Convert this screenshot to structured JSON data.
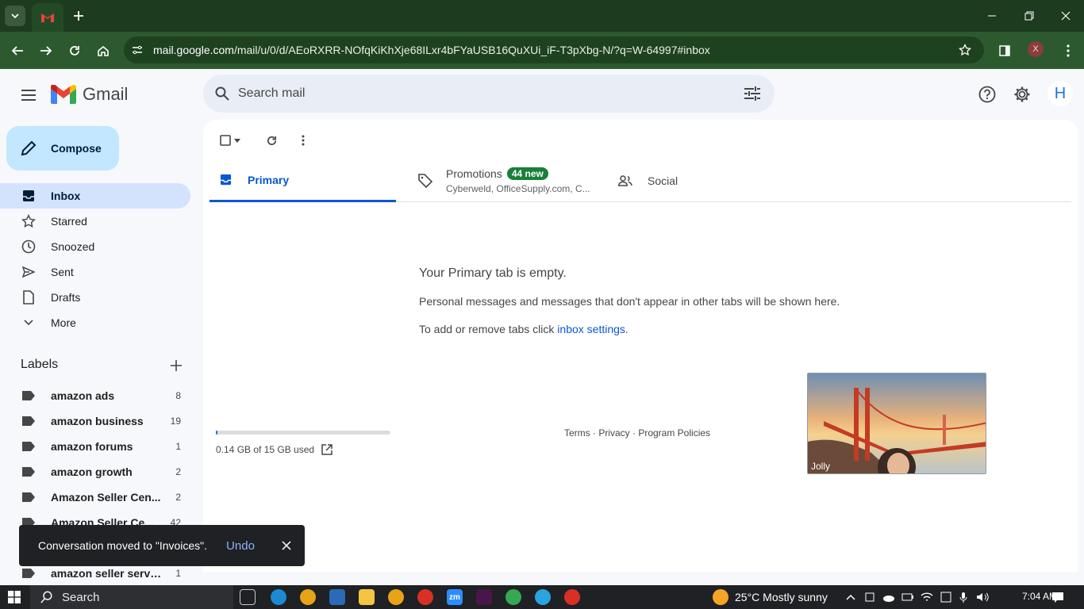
{
  "browser": {
    "url_host": "mail.google.com",
    "url_path": "/mail/u/0/d/AEoRXRR-NOfqKiKhXje68ILxr4bFYaUSB16QuXUi_iF-T3pXbg-N/?q=W-64997#inbox",
    "profile_initial": "X"
  },
  "header": {
    "brand": "Gmail",
    "search_placeholder": "Search mail",
    "account_initial": "H"
  },
  "sidebar": {
    "compose_label": "Compose",
    "items": [
      {
        "label": "Inbox",
        "icon": "inbox-icon"
      },
      {
        "label": "Starred",
        "icon": "star-icon"
      },
      {
        "label": "Snoozed",
        "icon": "clock-icon"
      },
      {
        "label": "Sent",
        "icon": "send-icon"
      },
      {
        "label": "Drafts",
        "icon": "draft-icon"
      },
      {
        "label": "More",
        "icon": "chevron-down-icon"
      }
    ],
    "labels_title": "Labels",
    "labels": [
      {
        "name": "amazon ads",
        "count": "8"
      },
      {
        "name": "amazon business",
        "count": "19"
      },
      {
        "name": "amazon forums",
        "count": "1"
      },
      {
        "name": "amazon growth",
        "count": "2"
      },
      {
        "name": "Amazon Seller Cen...",
        "count": "2"
      },
      {
        "name": "Amazon Seller Ce...",
        "count": "42"
      },
      {
        "name": "",
        "count": ""
      },
      {
        "name": "amazon seller servi...",
        "count": "1"
      }
    ]
  },
  "main": {
    "tabs": {
      "primary": "Primary",
      "promotions": "Promotions",
      "promotions_badge": "44 new",
      "promotions_sub": "Cyberweld, OfficeSupply.com, C...",
      "social": "Social"
    },
    "empty_title": "Your Primary tab is empty.",
    "empty_desc": "Personal messages and messages that don't appear in other tabs will be shown here.",
    "empty_settings_prefix": "To add or remove tabs click ",
    "empty_settings_link": "inbox settings",
    "empty_settings_suffix": ".",
    "storage_text": "0.14 GB of 15 GB used",
    "storage_fraction": 0.0093,
    "footer_links": "Terms · Privacy · Program Policies",
    "video_name": "Jolly"
  },
  "snackbar": {
    "text": "Conversation moved to \"Invoices\".",
    "undo": "Undo"
  },
  "taskbar": {
    "search_label": "Search",
    "weather": "25°C  Mostly sunny",
    "time": "7:04 AM"
  },
  "colors": {
    "accent": "#0b57d0",
    "compose_bg": "#c2e7ff",
    "active_nav_bg": "#d3e3fd",
    "promo_badge": "#188038"
  }
}
